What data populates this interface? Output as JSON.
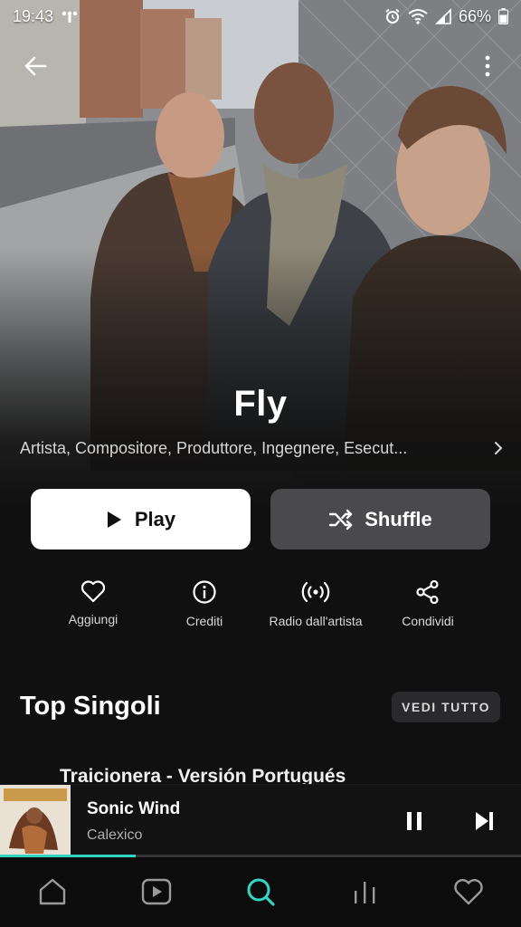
{
  "status_bar": {
    "time": "19:43",
    "battery": "66%"
  },
  "artist": {
    "name": "Fly",
    "roles": "Artista, Compositore, Produttore, Ingegnere, Esecut..."
  },
  "buttons": {
    "play_label": "Play",
    "shuffle_label": "Shuffle"
  },
  "actions": [
    {
      "label": "Aggiungi",
      "icon": "heart-outline-icon"
    },
    {
      "label": "Crediti",
      "icon": "info-icon"
    },
    {
      "label": "Radio dall'artista",
      "icon": "radio-icon"
    },
    {
      "label": "Condividi",
      "icon": "share-icon"
    }
  ],
  "top_singles": {
    "title": "Top Singoli",
    "see_all_label": "VEDI TUTTO",
    "first_track_peek": "Traicionera - Versión Portugués"
  },
  "now_playing": {
    "title": "Sonic Wind",
    "artist": "Calexico",
    "progress": 0.26
  },
  "bottom_nav": [
    {
      "icon": "home-icon",
      "active": false
    },
    {
      "icon": "videos-icon",
      "active": false
    },
    {
      "icon": "search-icon",
      "active": true
    },
    {
      "icon": "charts-icon",
      "active": false
    },
    {
      "icon": "heart-icon",
      "active": false
    }
  ],
  "colors": {
    "accent": "#33d6c4",
    "background": "#101010",
    "shuffle_bg": "#4a4a4c"
  }
}
